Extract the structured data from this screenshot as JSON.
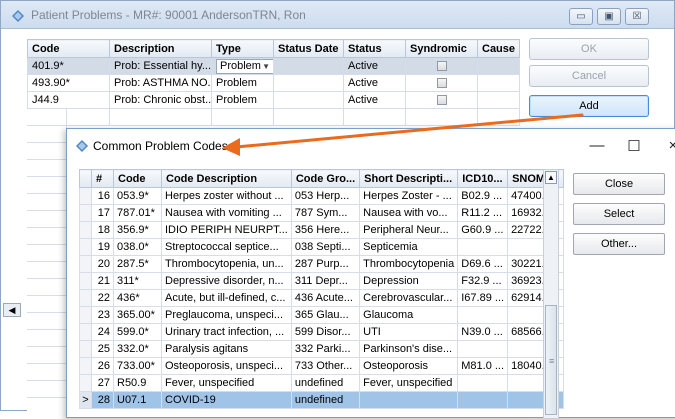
{
  "back_window": {
    "title": "Patient Problems - MR#: 90001  AndersonTRN, Ron",
    "columns": [
      "Code",
      "Description",
      "Type",
      "Status Date",
      "Status",
      "Syndromic",
      "Cause"
    ],
    "rows": [
      {
        "code": "401.9*",
        "description": "Prob: Essential hy...",
        "type": "Problem",
        "status_date": "",
        "status": "Active"
      },
      {
        "code": "493.90*",
        "description": "Prob: ASTHMA NO...",
        "type": "Problem",
        "status_date": "",
        "status": "Active"
      },
      {
        "code": "J44.9",
        "description": "Prob: Chronic obst...",
        "type": "Problem",
        "status_date": "",
        "status": "Active"
      }
    ],
    "buttons": {
      "ok": "OK",
      "cancel": "Cancel",
      "add": "Add"
    },
    "scroll_left": "◀",
    "controls": {
      "minimize": "▭",
      "maximize": "▣",
      "close": "☒"
    }
  },
  "front_window": {
    "title": "Common Problem Codes",
    "controls": {
      "minimize": "—",
      "maximize": "☐",
      "close": "×"
    },
    "columns": [
      "#",
      "Code",
      "Code Description",
      "Code Gro...",
      "Short Descripti...",
      "ICD10...",
      "SNOM..."
    ],
    "rows": [
      {
        "n": "16",
        "code": "053.9*",
        "desc": "Herpes zoster without ...",
        "group": "053 Herp...",
        "short": "Herpes Zoster - ...",
        "icd10": "B02.9 ...",
        "snomed": "47400..."
      },
      {
        "n": "17",
        "code": "787.01*",
        "desc": "Nausea with vomiting ...",
        "group": "787 Sym...",
        "short": "Nausea with vo...",
        "icd10": "R11.2 ...",
        "snomed": "16932..."
      },
      {
        "n": "18",
        "code": "356.9*",
        "desc": "IDIO PERIPH NEURPT...",
        "group": "356 Here...",
        "short": "Peripheral Neur...",
        "icd10": "G60.9 ...",
        "snomed": "22722..."
      },
      {
        "n": "19",
        "code": "038.0*",
        "desc": "Streptococcal septice...",
        "group": "038 Septi...",
        "short": "Septicemia",
        "icd10": "",
        "snomed": ""
      },
      {
        "n": "20",
        "code": "287.5*",
        "desc": "Thrombocytopenia, un...",
        "group": "287 Purp...",
        "short": "Thrombocytopenia",
        "icd10": "D69.6 ...",
        "snomed": "30221..."
      },
      {
        "n": "21",
        "code": "311*",
        "desc": "Depressive disorder, n...",
        "group": "311 Depr...",
        "short": "Depression",
        "icd10": "F32.9 ...",
        "snomed": "36923..."
      },
      {
        "n": "22",
        "code": "436*",
        "desc": "Acute, but ill-defined, c...",
        "group": "436 Acute...",
        "short": "Cerebrovascular...",
        "icd10": "I67.89 ...",
        "snomed": "62914..."
      },
      {
        "n": "23",
        "code": "365.00*",
        "desc": "Preglaucoma, unspeci...",
        "group": "365 Glau...",
        "short": "Glaucoma",
        "icd10": "",
        "snomed": ""
      },
      {
        "n": "24",
        "code": "599.0*",
        "desc": "Urinary tract infection, ...",
        "group": "599 Disor...",
        "short": "UTI",
        "icd10": "N39.0 ...",
        "snomed": "68566..."
      },
      {
        "n": "25",
        "code": "332.0*",
        "desc": "Paralysis agitans",
        "group": "332 Parki...",
        "short": "Parkinson's dise...",
        "icd10": "",
        "snomed": ""
      },
      {
        "n": "26",
        "code": "733.00*",
        "desc": "Osteoporosis, unspeci...",
        "group": "733 Other...",
        "short": "Osteoporosis",
        "icd10": "M81.0 ...",
        "snomed": "18040..."
      },
      {
        "n": "27",
        "code": "R50.9",
        "desc": "Fever, unspecified",
        "group": "undefined",
        "short": "Fever, unspecified",
        "icd10": "",
        "snomed": ""
      },
      {
        "n": "28",
        "code": "U07.1",
        "desc": "COVID-19",
        "group": "undefined",
        "short": "",
        "icd10": "",
        "snomed": ""
      }
    ],
    "current_row_marker": ">",
    "buttons": {
      "close": "Close",
      "select": "Select",
      "other": "Other..."
    }
  },
  "colors": {
    "selected_row": "#9fc4e8",
    "arrow": "#ea6a1e",
    "add_button_border": "#4a8bd6"
  }
}
